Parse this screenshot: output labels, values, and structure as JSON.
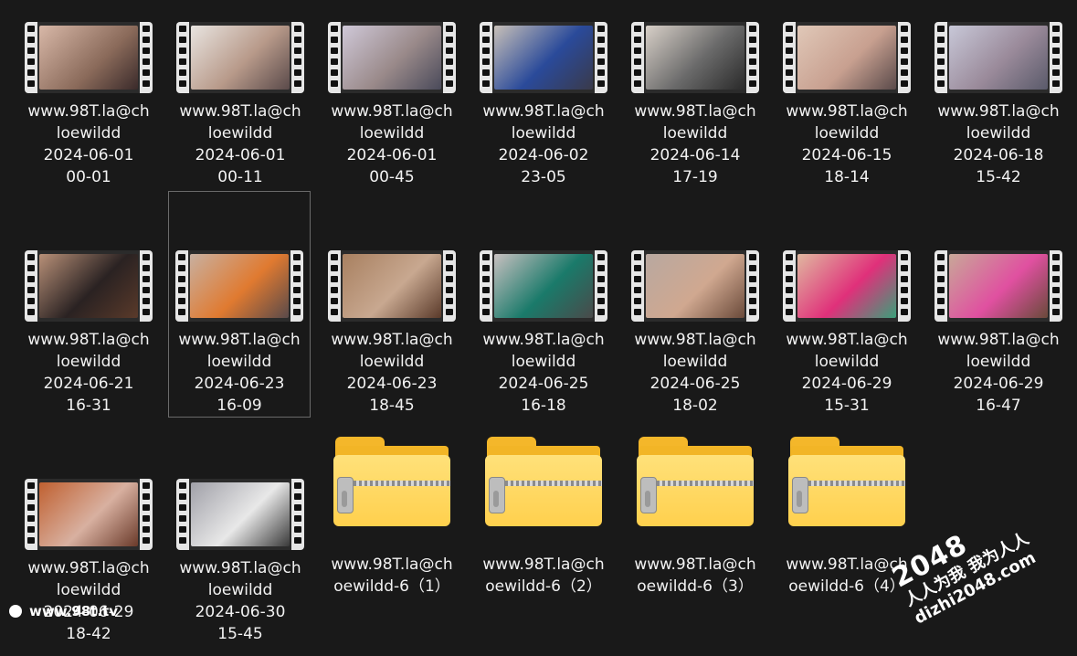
{
  "items": [
    {
      "type": "video",
      "line1": "www.98T.la@ch",
      "line2": "loewildd",
      "line3": "2024-06-01",
      "line4": "00-01"
    },
    {
      "type": "video",
      "line1": "www.98T.la@ch",
      "line2": "loewildd",
      "line3": "2024-06-01",
      "line4": "00-11"
    },
    {
      "type": "video",
      "line1": "www.98T.la@ch",
      "line2": "loewildd",
      "line3": "2024-06-01",
      "line4": "00-45"
    },
    {
      "type": "video",
      "line1": "www.98T.la@ch",
      "line2": "loewildd",
      "line3": "2024-06-02",
      "line4": "23-05"
    },
    {
      "type": "video",
      "line1": "www.98T.la@ch",
      "line2": "loewildd",
      "line3": "2024-06-14",
      "line4": "17-19"
    },
    {
      "type": "video",
      "line1": "www.98T.la@ch",
      "line2": "loewildd",
      "line3": "2024-06-15",
      "line4": "18-14"
    },
    {
      "type": "video",
      "line1": "www.98T.la@ch",
      "line2": "loewildd",
      "line3": "2024-06-18",
      "line4": "15-42"
    },
    {
      "type": "video",
      "line1": "www.98T.la@ch",
      "line2": "loewildd",
      "line3": "2024-06-21",
      "line4": "16-31"
    },
    {
      "type": "video",
      "line1": "www.98T.la@ch",
      "line2": "loewildd",
      "line3": "2024-06-23",
      "line4": "16-09"
    },
    {
      "type": "video",
      "line1": "www.98T.la@ch",
      "line2": "loewildd",
      "line3": "2024-06-23",
      "line4": "18-45"
    },
    {
      "type": "video",
      "line1": "www.98T.la@ch",
      "line2": "loewildd",
      "line3": "2024-06-25",
      "line4": "16-18"
    },
    {
      "type": "video",
      "line1": "www.98T.la@ch",
      "line2": "loewildd",
      "line3": "2024-06-25",
      "line4": "18-02"
    },
    {
      "type": "video",
      "line1": "www.98T.la@ch",
      "line2": "loewildd",
      "line3": "2024-06-29",
      "line4": "15-31"
    },
    {
      "type": "video",
      "line1": "www.98T.la@ch",
      "line2": "loewildd",
      "line3": "2024-06-29",
      "line4": "16-47"
    },
    {
      "type": "video",
      "line1": "www.98T.la@ch",
      "line2": "loewildd",
      "line3": "2024-06-29",
      "line4": "18-42"
    },
    {
      "type": "video",
      "line1": "www.98T.la@ch",
      "line2": "loewildd",
      "line3": "2024-06-30",
      "line4": "15-45"
    },
    {
      "type": "zip",
      "line1": "www.98T.la@ch",
      "line2": "oewildd-6（1）"
    },
    {
      "type": "zip",
      "line1": "www.98T.la@ch",
      "line2": "oewildd-6（2）"
    },
    {
      "type": "zip",
      "line1": "www.98T.la@ch",
      "line2": "oewildd-6（3）"
    },
    {
      "type": "zip",
      "line1": "www.98T.la@ch",
      "line2": "oewildd-6（4）"
    }
  ],
  "watermark_left": "www.98t.tv",
  "watermark_right": {
    "big": "2048",
    "line1": "人人为我 我为人人",
    "line2": "dizhi2048.com"
  },
  "colors": {
    "background": "#191919",
    "text": "#f2f2f2",
    "folder": "#ffd04d"
  }
}
